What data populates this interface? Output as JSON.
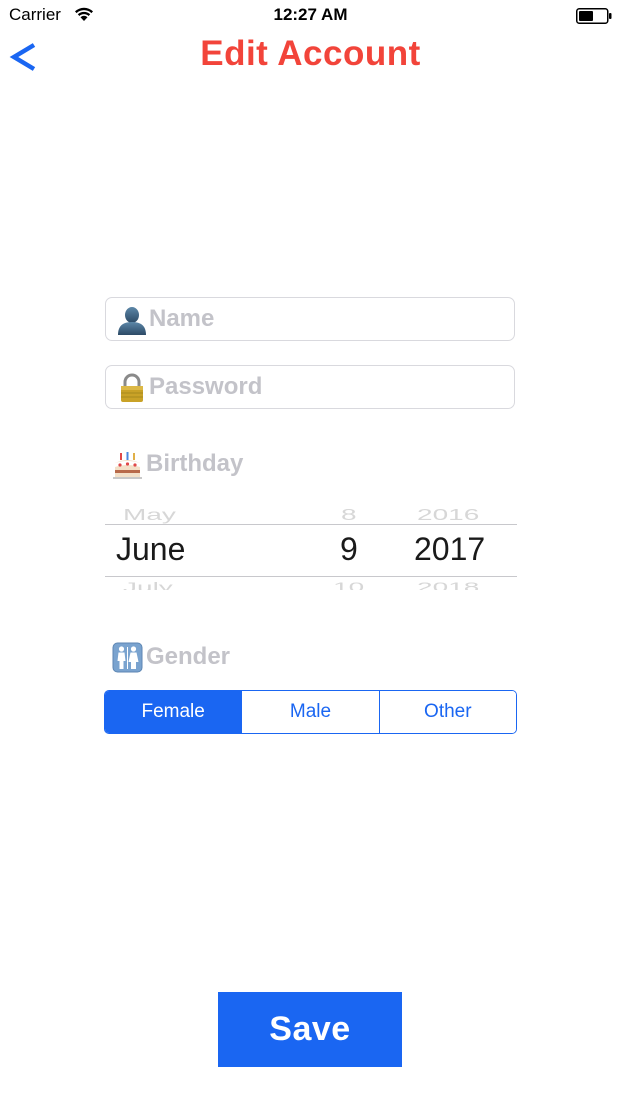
{
  "status_bar": {
    "carrier": "Carrier",
    "time": "12:27 AM",
    "wifi_icon": "wifi-icon",
    "battery_icon": "battery-icon"
  },
  "nav": {
    "back_label": "<",
    "title": "Edit Account",
    "title_color": "#f2443a"
  },
  "form": {
    "name": {
      "icon": "person-silhouette-icon",
      "placeholder": "Name",
      "value": ""
    },
    "password": {
      "icon": "padlock-icon",
      "placeholder": "Password",
      "value": ""
    },
    "birthday": {
      "icon": "birthday-cake-icon",
      "label": "Birthday",
      "picker": {
        "month": {
          "prev": "May",
          "selected": "June",
          "next": "July"
        },
        "day": {
          "prev": "8",
          "selected": "9",
          "next": "10"
        },
        "year": {
          "prev": "2016",
          "selected": "2017",
          "next": "2018"
        }
      }
    },
    "gender": {
      "icon": "restroom-icon",
      "label": "Gender",
      "options": [
        "Female",
        "Male",
        "Other"
      ],
      "selected": "Female"
    }
  },
  "save_button": {
    "label": "Save"
  },
  "colors": {
    "accent": "#1a66f2",
    "placeholder": "#c3c3c9",
    "title": "#f2443a"
  }
}
